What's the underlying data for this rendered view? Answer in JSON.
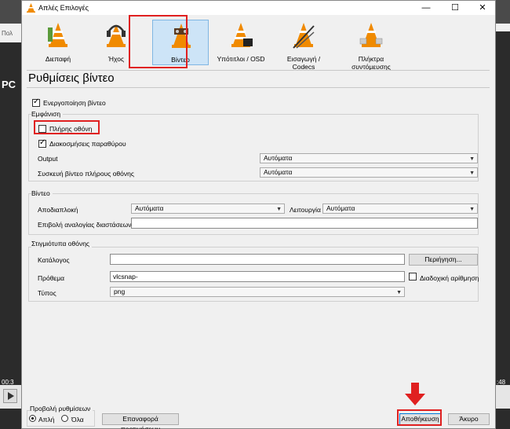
{
  "background": {
    "menu_left_text": "Πολ",
    "logo_text": "PC",
    "time_left": "00:3",
    "time_right": ":48"
  },
  "window": {
    "title": "Απλές Επιλογές",
    "minimize": "—",
    "maximize": "☐",
    "close": "✕"
  },
  "categories": [
    {
      "label": "Διεπαφή",
      "icon": "interface-cone-icon"
    },
    {
      "label": "Ήχος",
      "icon": "audio-headphones-cone-icon"
    },
    {
      "label": "Βίντεο",
      "icon": "video-cone-icon"
    },
    {
      "label": "Υπότιτλοι / OSD",
      "icon": "subtitles-cone-icon"
    },
    {
      "label": "Εισαγωγή / Codecs",
      "icon": "input-codecs-cone-icon"
    },
    {
      "label": "Πλήκτρα συντόμευσης",
      "icon": "hotkeys-cone-icon"
    }
  ],
  "page_title": "Ρυθμίσεις βίντεο",
  "enable_video": {
    "label": "Ενεργοποίηση βίντεο",
    "checked": true
  },
  "display": {
    "title": "Εμφάνιση",
    "fullscreen": {
      "label": "Πλήρης οθόνη",
      "checked": false
    },
    "window_decorations": {
      "label": "Διακοσμήσεις παραθύρου",
      "checked": true
    },
    "output": {
      "label": "Output",
      "value": "Αυτόματα"
    },
    "fullscreen_device": {
      "label": "Συσκευή βίντεο πλήρους οθόνης",
      "value": "Αυτόματα"
    }
  },
  "video": {
    "title": "Βίντεο",
    "deinterlace": {
      "label": "Αποδιαπλοκή",
      "value": "Αυτόματα"
    },
    "mode": {
      "label": "Λειτουργία",
      "value": "Αυτόματα"
    },
    "aspect": {
      "label": "Επιβολή αναλογίας διαστάσεων",
      "value": ""
    }
  },
  "snapshots": {
    "title": "Στιγμιότυπα οθόνης",
    "directory": {
      "label": "Κατάλογος",
      "value": ""
    },
    "browse_button": "Περιήγηση...",
    "prefix": {
      "label": "Πρόθεμα",
      "value": "vlcsnap-"
    },
    "sequential": {
      "label": "Διαδοχική αρίθμηση",
      "checked": false
    },
    "type": {
      "label": "Τύπος",
      "value": "png"
    }
  },
  "footer": {
    "show_settings_title": "Προβολή ρυθμίσεων",
    "simple": {
      "label": "Απλή",
      "selected": true
    },
    "all": {
      "label": "Όλα",
      "selected": false
    },
    "reset_button": "Επαναφορά προτιμήσεων",
    "save_button": "Αποθήκευση",
    "cancel_button": "Άκυρο"
  }
}
